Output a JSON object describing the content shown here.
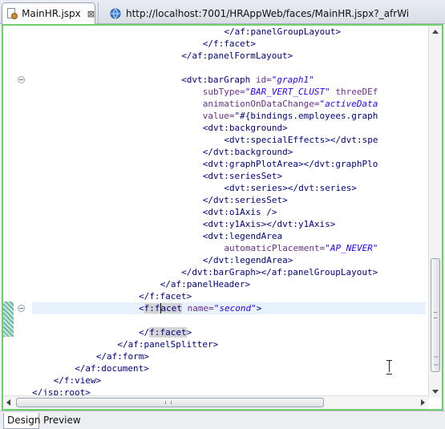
{
  "tabs": {
    "active": {
      "label": "MainHR.jspx",
      "close": "⊠"
    },
    "inactive": {
      "label": "http://localhost:7001/HRAppWeb/faces/MainHR.jspx?_afrWi"
    }
  },
  "editor": {
    "lines": [
      {
        "indent": 36,
        "parts": [
          [
            "t",
            "</af:panelGroupLayout>"
          ]
        ]
      },
      {
        "indent": 32,
        "parts": [
          [
            "t",
            "</f:facet>"
          ]
        ]
      },
      {
        "indent": 28,
        "parts": [
          [
            "t",
            "</af:panelFormLayout>"
          ]
        ]
      },
      {
        "indent": 0,
        "parts": []
      },
      {
        "indent": 28,
        "parts": [
          [
            "t",
            "<dvt:barGraph "
          ],
          [
            "a",
            "id="
          ],
          [
            "v",
            "\"graph1\""
          ]
        ]
      },
      {
        "indent": 32,
        "parts": [
          [
            "a",
            "subType="
          ],
          [
            "v",
            "\"BAR_VERT_CLUST\""
          ],
          [
            "a",
            " threeDEf"
          ]
        ]
      },
      {
        "indent": 32,
        "parts": [
          [
            "a",
            "animationOnDataChange="
          ],
          [
            "v",
            "\"activeData"
          ]
        ]
      },
      {
        "indent": 32,
        "parts": [
          [
            "a",
            "value="
          ],
          [
            "t",
            "\"#{bindings.employees.graph"
          ]
        ]
      },
      {
        "indent": 32,
        "parts": [
          [
            "t",
            "<dvt:background>"
          ]
        ]
      },
      {
        "indent": 36,
        "parts": [
          [
            "t",
            "<dvt:specialEffects></dvt:spe"
          ]
        ]
      },
      {
        "indent": 32,
        "parts": [
          [
            "t",
            "</dvt:background>"
          ]
        ]
      },
      {
        "indent": 32,
        "parts": [
          [
            "t",
            "<dvt:graphPlotArea></dvt:graphPlo"
          ]
        ]
      },
      {
        "indent": 32,
        "parts": [
          [
            "t",
            "<dvt:seriesSet>"
          ]
        ]
      },
      {
        "indent": 36,
        "parts": [
          [
            "t",
            "<dvt:series></dvt:series>"
          ]
        ]
      },
      {
        "indent": 32,
        "parts": [
          [
            "t",
            "</dvt:seriesSet>"
          ]
        ]
      },
      {
        "indent": 32,
        "parts": [
          [
            "t",
            "<dvt:o1Axis />"
          ]
        ]
      },
      {
        "indent": 32,
        "parts": [
          [
            "t",
            "<dvt:y1Axis></dvt:y1Axis>"
          ]
        ]
      },
      {
        "indent": 32,
        "parts": [
          [
            "t",
            "<dvt:legendArea"
          ]
        ]
      },
      {
        "indent": 36,
        "parts": [
          [
            "a",
            "automaticPlacement="
          ],
          [
            "v",
            "\"AP_NEVER\""
          ]
        ]
      },
      {
        "indent": 32,
        "parts": [
          [
            "t",
            "</dvt:legendArea>"
          ]
        ]
      },
      {
        "indent": 28,
        "parts": [
          [
            "t",
            "</dvt:barGraph></af:panelGroupLayout>"
          ]
        ]
      },
      {
        "indent": 24,
        "parts": [
          [
            "t",
            "</af:panelHeader>"
          ]
        ]
      },
      {
        "indent": 20,
        "parts": [
          [
            "t",
            "</f:facet>"
          ]
        ]
      },
      {
        "indent": 20,
        "parts": [
          [
            "t",
            "<"
          ],
          [
            "m",
            "f:f"
          ],
          [
            "c",
            ""
          ],
          [
            "m",
            "acet"
          ],
          [
            "a",
            " name="
          ],
          [
            "v",
            "\"second\""
          ],
          [
            "t",
            ">"
          ]
        ]
      },
      {
        "indent": 0,
        "parts": []
      },
      {
        "indent": 20,
        "parts": [
          [
            "t",
            "</"
          ],
          [
            "m",
            "f:facet"
          ],
          [
            "t",
            ">"
          ]
        ]
      },
      {
        "indent": 16,
        "parts": [
          [
            "t",
            "</af:panelSplitter>"
          ]
        ]
      },
      {
        "indent": 12,
        "parts": [
          [
            "t",
            "</af:form>"
          ]
        ]
      },
      {
        "indent": 8,
        "parts": [
          [
            "t",
            "</af:document>"
          ]
        ]
      },
      {
        "indent": 4,
        "parts": [
          [
            "t",
            "</f:view>"
          ]
        ]
      },
      {
        "indent": 0,
        "parts": [
          [
            "t",
            "</jsp:root>"
          ]
        ]
      }
    ],
    "highlight_line": 23,
    "fold_lines": [
      4,
      23
    ]
  },
  "bottom_tabs": {
    "design": "Design",
    "preview": "Preview"
  },
  "colors": {
    "frame": "#6ccf6c",
    "tag": "#000080",
    "attr": "#6b2d8a",
    "value": "#2a00ff",
    "highlight": "#e8f2fe"
  }
}
